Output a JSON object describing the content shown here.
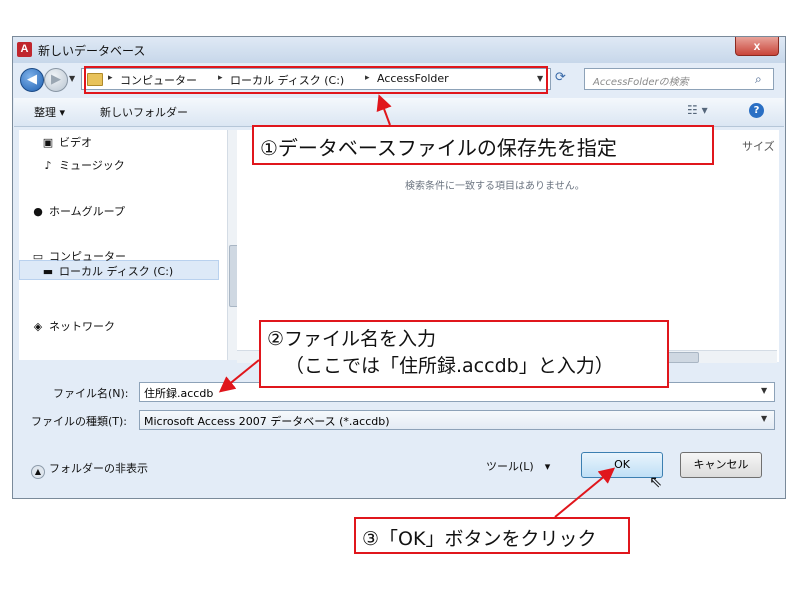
{
  "window": {
    "title": "新しいデータベース",
    "app_icon": "A",
    "close_label": "x"
  },
  "nav": {
    "back_icon": "back-arrow-icon",
    "forward_icon": "forward-arrow-icon",
    "address": [
      "コンピューター",
      "ローカル ディスク (C:)",
      "AccessFolder"
    ],
    "search_placeholder": "AccessFolderの検索"
  },
  "toolbar": {
    "organize_label": "整理 ▾",
    "new_folder_label": "新しいフォルダー"
  },
  "navpane": {
    "items": [
      {
        "label": "ビデオ",
        "icon": "video-icon"
      },
      {
        "label": "ミュージック",
        "icon": "music-icon"
      },
      {
        "label": "ホームグループ",
        "icon": "homegroup-icon"
      },
      {
        "label": "コンピューター",
        "icon": "computer-icon"
      },
      {
        "label": "ローカル ディスク (C:)",
        "icon": "disk-icon"
      },
      {
        "label": "ネットワーク",
        "icon": "network-icon"
      }
    ]
  },
  "content": {
    "size_column": "サイズ",
    "empty_message": "検索条件に一致する項目はありません。"
  },
  "form": {
    "filename_label": "ファイル名(N):",
    "filename_value": "住所録.accdb",
    "filetype_label": "ファイルの種類(T):",
    "filetype_value": "Microsoft Access 2007 データベース (*.accdb)"
  },
  "footer": {
    "hide_folders_label": "フォルダーの非表示",
    "tools_label": "ツール(L)　▾",
    "ok_label": "OK",
    "cancel_label": "キャンセル"
  },
  "annotations": {
    "callout1": "①データベースファイルの保存先を指定",
    "callout2_line1": "②ファイル名を入力",
    "callout2_line2": "（ここでは「住所録.accdb」と入力）",
    "callout3": "③「OK」ボタンをクリック"
  },
  "colors": {
    "annotation_red": "#e0161c",
    "window_bg": "#e3ecf7"
  }
}
